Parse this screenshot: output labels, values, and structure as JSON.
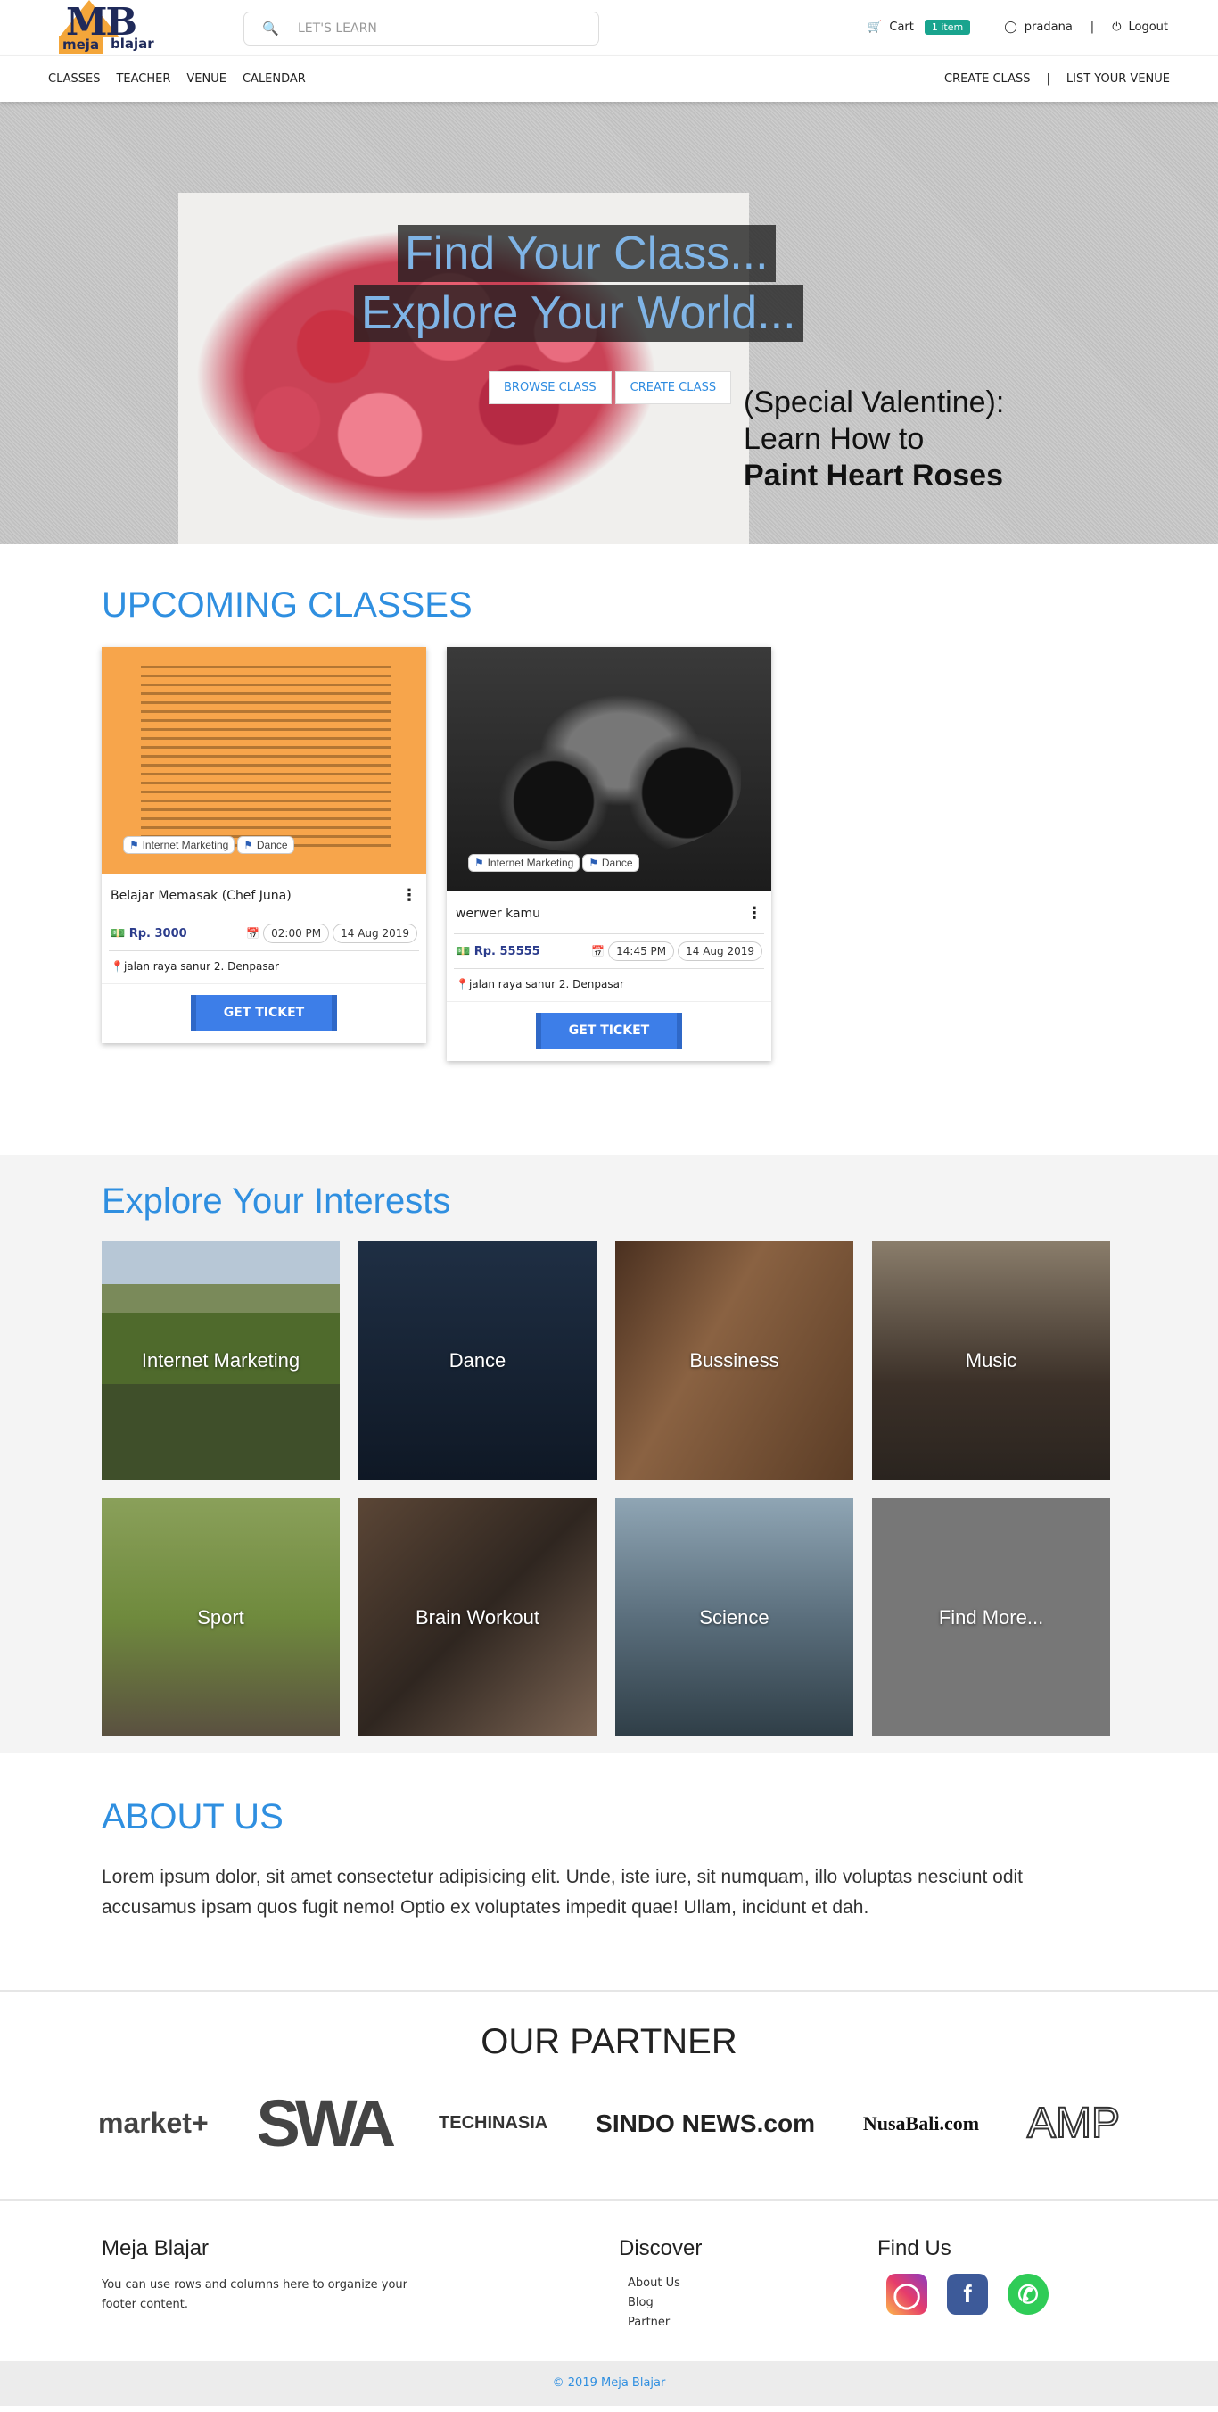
{
  "header": {
    "brand_word1": "meja",
    "brand_word2": "blajar",
    "search_placeholder": "LET'S LEARN",
    "cart_label": "Cart",
    "cart_badge": "1 item",
    "user_name": "pradana",
    "logout_label": "Logout"
  },
  "nav": {
    "left": [
      "CLASSES",
      "TEACHER",
      "VENUE",
      "CALENDAR"
    ],
    "create_class": "CREATE CLASS",
    "separator": "|",
    "list_venue": "LIST YOUR VENUE"
  },
  "hero": {
    "line1": "Find Your Class...",
    "line2": "Explore Your World...",
    "browse_button": "BROWSE CLASS",
    "create_button": "CREATE CLASS",
    "promo_line1": "(Special Valentine):",
    "promo_line2": "Learn How to",
    "promo_line3": "Paint Heart Roses"
  },
  "upcoming": {
    "title": "UPCOMING CLASSES",
    "cards": [
      {
        "title": "Belajar Memasak (Chef Juna)",
        "tags": [
          "Internet Marketing",
          "Dance"
        ],
        "price": "Rp. 3000",
        "time": "02:00 PM",
        "date": "14 Aug 2019",
        "location": "jalan raya sanur 2. Denpasar",
        "button": "GET TICKET"
      },
      {
        "title": "werwer kamu",
        "tags": [
          "Internet Marketing",
          "Dance"
        ],
        "price": "Rp. 55555",
        "time": "14:45 PM",
        "date": "14 Aug 2019",
        "location": "jalan raya sanur 2. Denpasar",
        "button": "GET TICKET"
      }
    ]
  },
  "interests": {
    "title": "Explore Your Interests",
    "tiles": [
      "Internet Marketing",
      "Dance",
      "Bussiness",
      "Music",
      "Sport",
      "Brain Workout",
      "Science",
      "Find More..."
    ]
  },
  "about": {
    "title": "ABOUT US",
    "text": "Lorem ipsum dolor, sit amet consectetur adipisicing elit. Unde, iste iure, sit numquam, illo voluptas nesciunt odit accusamus ipsam quos fugit nemo! Optio ex voluptates impedit quae! Ullam, incidunt et dah."
  },
  "partner": {
    "title": "OUR PARTNER",
    "logos": [
      "market+",
      "SWA",
      "TECHINASIA",
      "SINDO NEWS.com",
      "NusaBali.com",
      "AMP"
    ]
  },
  "footer": {
    "brand": "Meja Blajar",
    "text": "You can use rows and columns here to organize your footer content.",
    "discover_title": "Discover",
    "links": [
      "About Us",
      "Blog",
      "Partner"
    ],
    "find_us_title": "Find Us",
    "copyright": "© 2019 Meja Blajar"
  }
}
